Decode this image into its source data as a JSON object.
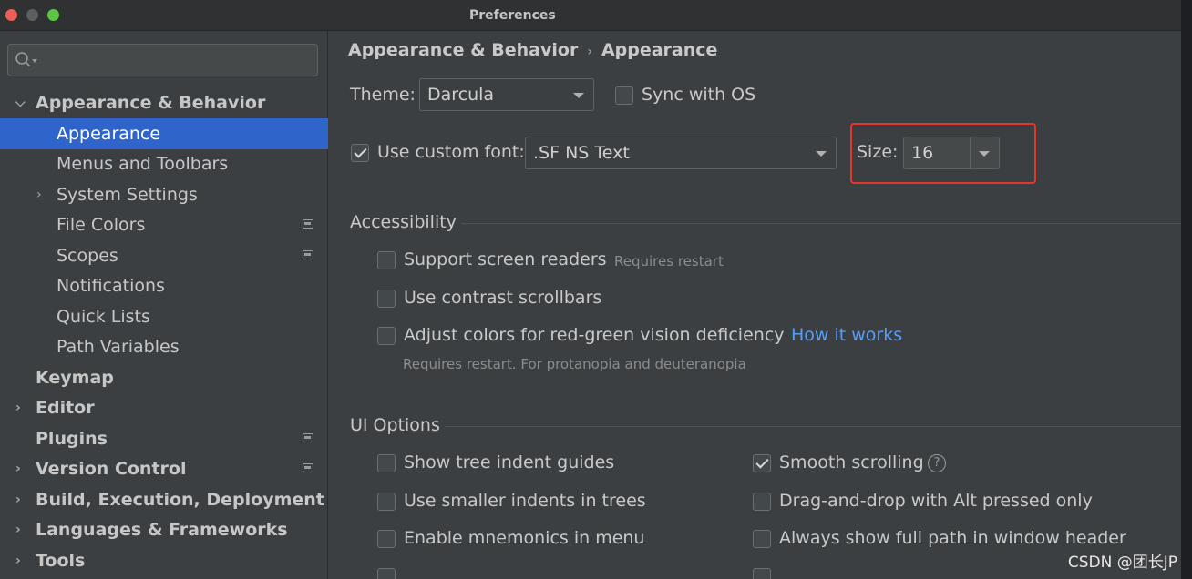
{
  "window": {
    "title": "Preferences"
  },
  "sidebar": {
    "items": [
      {
        "label": "Appearance & Behavior",
        "level": 0,
        "expanded": true,
        "bold": true
      },
      {
        "label": "Appearance",
        "level": 1,
        "selected": true
      },
      {
        "label": "Menus and Toolbars",
        "level": 1
      },
      {
        "label": "System Settings",
        "level": 1,
        "collapsed": true
      },
      {
        "label": "File Colors",
        "level": 1,
        "project_icon": true
      },
      {
        "label": "Scopes",
        "level": 1,
        "project_icon": true
      },
      {
        "label": "Notifications",
        "level": 1
      },
      {
        "label": "Quick Lists",
        "level": 1
      },
      {
        "label": "Path Variables",
        "level": 1
      },
      {
        "label": "Keymap",
        "level": 0,
        "bold": true
      },
      {
        "label": "Editor",
        "level": 0,
        "collapsed": true,
        "bold": true
      },
      {
        "label": "Plugins",
        "level": 0,
        "bold": true,
        "project_icon": true
      },
      {
        "label": "Version Control",
        "level": 0,
        "collapsed": true,
        "bold": true,
        "project_icon": true
      },
      {
        "label": "Build, Execution, Deployment",
        "level": 0,
        "collapsed": true,
        "bold": true
      },
      {
        "label": "Languages & Frameworks",
        "level": 0,
        "collapsed": true,
        "bold": true
      },
      {
        "label": "Tools",
        "level": 0,
        "collapsed": true,
        "bold": true
      }
    ]
  },
  "breadcrumb": {
    "parent": "Appearance & Behavior",
    "separator": "›",
    "current": "Appearance"
  },
  "theme": {
    "label": "Theme:",
    "value": "Darcula",
    "sync_label": "Sync with OS",
    "sync_checked": false
  },
  "font": {
    "checkbox_label": "Use custom font:",
    "checked": true,
    "value": ".SF NS Text",
    "size_label": "Size:",
    "size_value": "16"
  },
  "accessibility": {
    "title": "Accessibility",
    "screen_readers": {
      "label": "Support screen readers",
      "hint": "Requires restart",
      "checked": false
    },
    "contrast": {
      "label": "Use contrast scrollbars",
      "checked": false
    },
    "colors": {
      "label": "Adjust colors for red-green vision deficiency",
      "link": "How it works",
      "hint": "Requires restart. For protanopia and deuteranopia",
      "checked": false
    }
  },
  "ui_options": {
    "title": "UI Options",
    "left": [
      {
        "label": "Show tree indent guides",
        "checked": false
      },
      {
        "label": "Use smaller indents in trees",
        "checked": false
      },
      {
        "label": "Enable mnemonics in menu",
        "checked": false
      }
    ],
    "right": [
      {
        "label": "Smooth scrolling",
        "checked": true,
        "help": "?"
      },
      {
        "label": "Drag-and-drop with Alt pressed only",
        "checked": false
      },
      {
        "label": "Always show full path in window header",
        "checked": false
      }
    ]
  },
  "watermark": "CSDN @团长JP",
  "colors": {
    "selection": "#2f65ca",
    "link": "#589df6",
    "highlight_border": "#e0392b"
  }
}
